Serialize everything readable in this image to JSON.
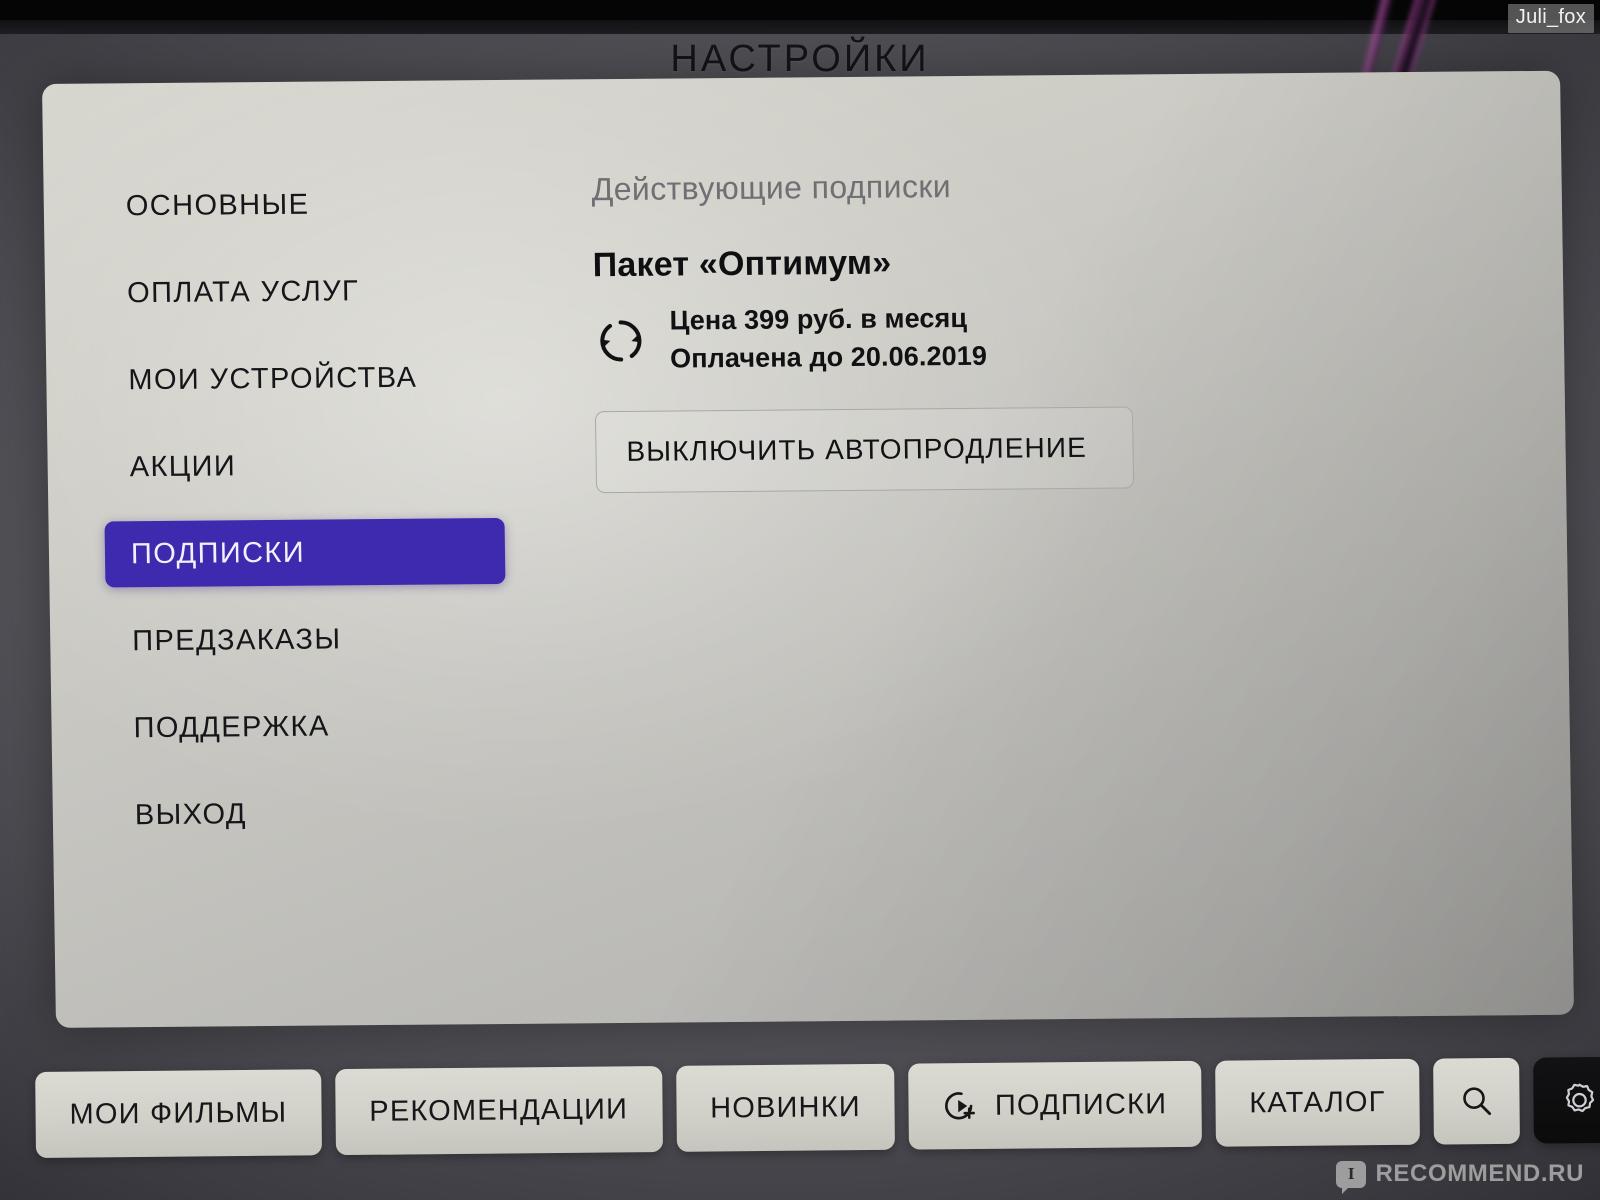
{
  "window": {
    "title": "НАСТРОЙКИ"
  },
  "sidebar": {
    "items": [
      {
        "label": "ОСНОВНЫЕ",
        "selected": false
      },
      {
        "label": "ОПЛАТА УСЛУГ",
        "selected": false
      },
      {
        "label": "МОИ УСТРОЙСТВА",
        "selected": false
      },
      {
        "label": "АКЦИИ",
        "selected": false
      },
      {
        "label": "ПОДПИСКИ",
        "selected": true
      },
      {
        "label": "ПРЕДЗАКАЗЫ",
        "selected": false
      },
      {
        "label": "ПОДДЕРЖКА",
        "selected": false
      },
      {
        "label": "ВЫХОД",
        "selected": false
      }
    ],
    "selected_color": "#3d2aae",
    "selected_text_color": "#f2f0fb"
  },
  "content": {
    "heading": "Действующие подписки",
    "subscription": {
      "title": "Пакет «Оптимум»",
      "renew_icon": "autorenew-icon",
      "price_line": "Цена 399 руб. в месяц",
      "paid_until_line": "Оплачена до 20.06.2019",
      "price_value": "399",
      "currency": "руб.",
      "period": "в месяц",
      "paid_until_date": "20.06.2019"
    },
    "auto_renew_button": "ВЫКЛЮЧИТЬ АВТОПРОДЛЕНИЕ"
  },
  "bottom_bar": {
    "items": [
      {
        "label": "МОИ ФИЛЬМЫ",
        "icon": null,
        "kind": "text",
        "active": false
      },
      {
        "label": "РЕКОМЕНДАЦИИ",
        "icon": null,
        "kind": "text",
        "active": false
      },
      {
        "label": "НОВИНКИ",
        "icon": null,
        "kind": "text",
        "active": false
      },
      {
        "label": "ПОДПИСКИ",
        "icon": "play-circle-plus-icon",
        "kind": "icon-text",
        "active": false
      },
      {
        "label": "КАТАЛОГ",
        "icon": null,
        "kind": "text",
        "active": false
      },
      {
        "label": "",
        "icon": "search-icon",
        "kind": "icon-only",
        "active": false
      },
      {
        "label": "",
        "icon": "gear-icon",
        "kind": "icon-dark",
        "active": true
      }
    ]
  },
  "watermarks": {
    "top_right": "Juli_fox",
    "bottom_right_mark": "I",
    "bottom_right": "RECOMMEND.RU"
  },
  "colors": {
    "panel_bg": "#cfcec7",
    "accent_purple": "#3d2aae",
    "heading_gray": "#6f6f74",
    "text_dark": "#111114",
    "chip_bg": "#d2d1c9",
    "chip_dark_bg": "#0b0b0c"
  }
}
